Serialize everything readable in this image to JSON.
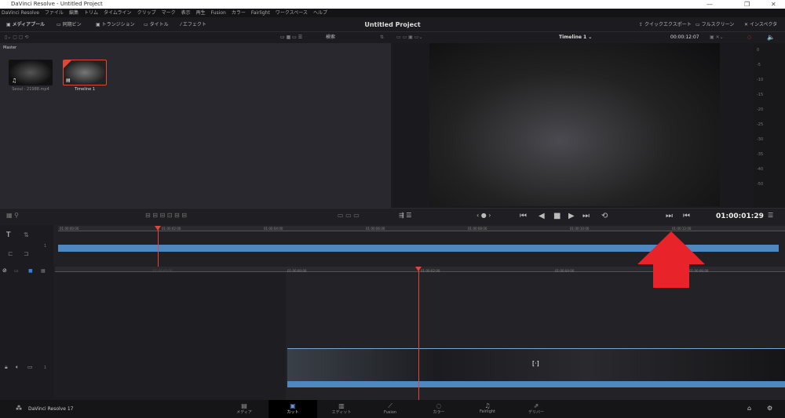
{
  "window": {
    "title": "DaVinci Resolve - Untitled Project",
    "min": "—",
    "max": "❐",
    "close": "✕"
  },
  "menu": [
    "DaVinci Resolve",
    "ファイル",
    "編集",
    "トリム",
    "タイムライン",
    "クリップ",
    "マーク",
    "表示",
    "再生",
    "Fusion",
    "カラー",
    "Fairlight",
    "ワークスペース",
    "ヘルプ"
  ],
  "toolbar": {
    "media_pool": "メディアプール",
    "sync_bin": "同期ビン",
    "transitions": "トランジション",
    "titles": "タイトル",
    "effects": "エフェクト",
    "project_title": "Untitled Project",
    "quick_export": "クイックエクスポート",
    "fullscreen": "フルスクリーン",
    "inspector": "インスペクタ"
  },
  "pool": {
    "search": "検索",
    "bin": "Master",
    "clips": [
      {
        "name": "Seoul - 21988.mp4"
      },
      {
        "name": "Timeline 1"
      }
    ]
  },
  "viewer": {
    "timeline_name": "Timeline 1 ⌄",
    "duration": "00:00:12:07",
    "meter_labels": [
      "0",
      "-5",
      "-10",
      "-15",
      "-20",
      "-25",
      "-30",
      "-35",
      "-40",
      "-50"
    ]
  },
  "transport": {
    "timecode": "01:00:01:29"
  },
  "upper_ruler": [
    "01:00:00:00",
    "01:00:02:00",
    "01:00:04:00",
    "01:00:06:00",
    "01:00:08:00",
    "01:00:10:00",
    "01:00:12:00"
  ],
  "lower_ruler": [
    "01:00:00:00",
    "01:00:00:00",
    "01:00:02:00",
    "01:00:04:00",
    "01:00:06:00"
  ],
  "tracks": {
    "upper": "1",
    "lower": "1"
  },
  "pages": {
    "brand": "DaVinci Resolve 17",
    "tabs": [
      "メディア",
      "カット",
      "エディット",
      "Fusion",
      "カラー",
      "Fairlight",
      "デリバー"
    ],
    "active": 1
  },
  "colors": {
    "accent": "#e0463a",
    "clip_blue": "#4d88c0",
    "arrow": "#e8242a"
  }
}
